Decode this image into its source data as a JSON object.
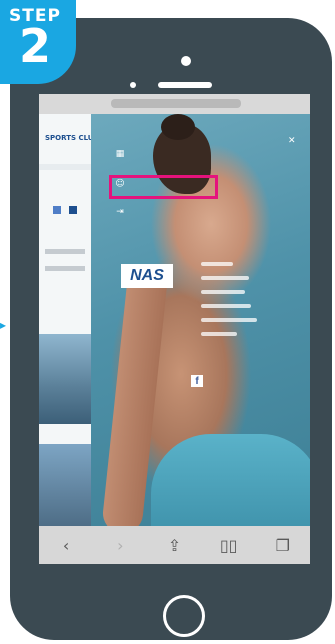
{
  "step": {
    "label": "STEP",
    "number": "2"
  },
  "browser": {
    "toolbar_icons": [
      "chevron-left-icon",
      "chevron-right-icon",
      "share-icon",
      "bookmarks-icon",
      "tabs-icon"
    ]
  },
  "site": {
    "left_logo": "SPORTS CLUB"
  },
  "menu": {
    "items": [
      {
        "icon": "calendar-icon",
        "label": ""
      },
      {
        "icon": "user-add-icon",
        "label": ""
      },
      {
        "icon": "login-icon",
        "label": ""
      }
    ]
  },
  "brand": {
    "logo_text": "NAS"
  },
  "social": {
    "facebook_glyph": "f"
  },
  "colors": {
    "accent": "#1aa7e2",
    "highlight": "#e5137d",
    "phone_body": "#3b4a52"
  }
}
